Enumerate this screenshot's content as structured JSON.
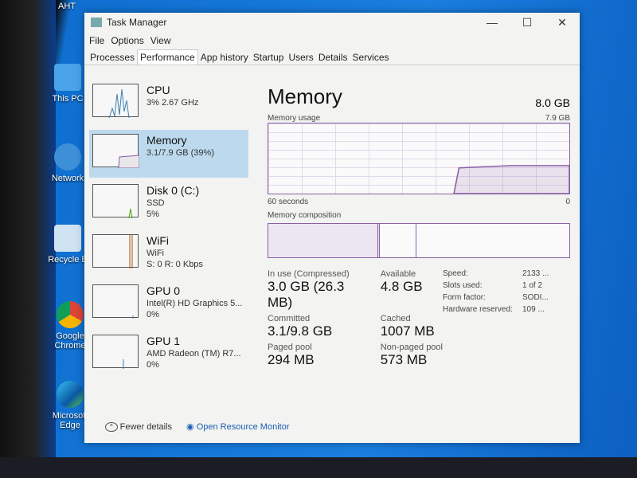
{
  "desktop": {
    "icons": [
      "AHT",
      "This PC",
      "Network",
      "Recycle B",
      "Google Chrome",
      "Microsoft Edge"
    ]
  },
  "window": {
    "title": "Task Manager",
    "minimize": "—",
    "maximize": "☐",
    "close": "✕"
  },
  "menu": [
    "File",
    "Options",
    "View"
  ],
  "tabs": [
    "Processes",
    "Performance",
    "App history",
    "Startup",
    "Users",
    "Details",
    "Services"
  ],
  "active_tab": "Performance",
  "sidebar": [
    {
      "name": "CPU",
      "line1": "3% 2.67 GHz",
      "line2": "",
      "color": "#3c7fb1"
    },
    {
      "name": "Memory",
      "line1": "3.1/7.9 GB (39%)",
      "line2": "",
      "color": "#8a5fa8",
      "selected": true
    },
    {
      "name": "Disk 0 (C:)",
      "line1": "SSD",
      "line2": "5%",
      "color": "#4da60c"
    },
    {
      "name": "WiFi",
      "line1": "WiFi",
      "line2": "S: 0 R: 0 Kbps",
      "color": "#a74f01"
    },
    {
      "name": "GPU 0",
      "line1": "Intel(R) HD Graphics 5...",
      "line2": "0%",
      "color": "#3c7fb1"
    },
    {
      "name": "GPU 1",
      "line1": "AMD Radeon (TM) R7...",
      "line2": "0%",
      "color": "#3c7fb1"
    }
  ],
  "main": {
    "title": "Memory",
    "total": "8.0 GB",
    "usage_label": "Memory usage",
    "usage_max": "7.9 GB",
    "time_left": "60 seconds",
    "time_right": "0",
    "composition_label": "Memory composition",
    "in_use_label": "In use (Compressed)",
    "in_use": "3.0 GB (26.3 MB)",
    "available_label": "Available",
    "available": "4.8 GB",
    "committed_label": "Committed",
    "committed": "3.1/9.8 GB",
    "cached_label": "Cached",
    "cached": "1007 MB",
    "paged_label": "Paged pool",
    "paged": "294 MB",
    "nonpaged_label": "Non-paged pool",
    "nonpaged": "573 MB",
    "specs": [
      [
        "Speed:",
        "2133 ..."
      ],
      [
        "Slots used:",
        "1 of 2"
      ],
      [
        "Form factor:",
        "SODI..."
      ],
      [
        "Hardware reserved:",
        "109 ..."
      ]
    ]
  },
  "footer": {
    "fewer": "Fewer details",
    "monitor": "Open Resource Monitor"
  },
  "accent": "#8a5fa8"
}
